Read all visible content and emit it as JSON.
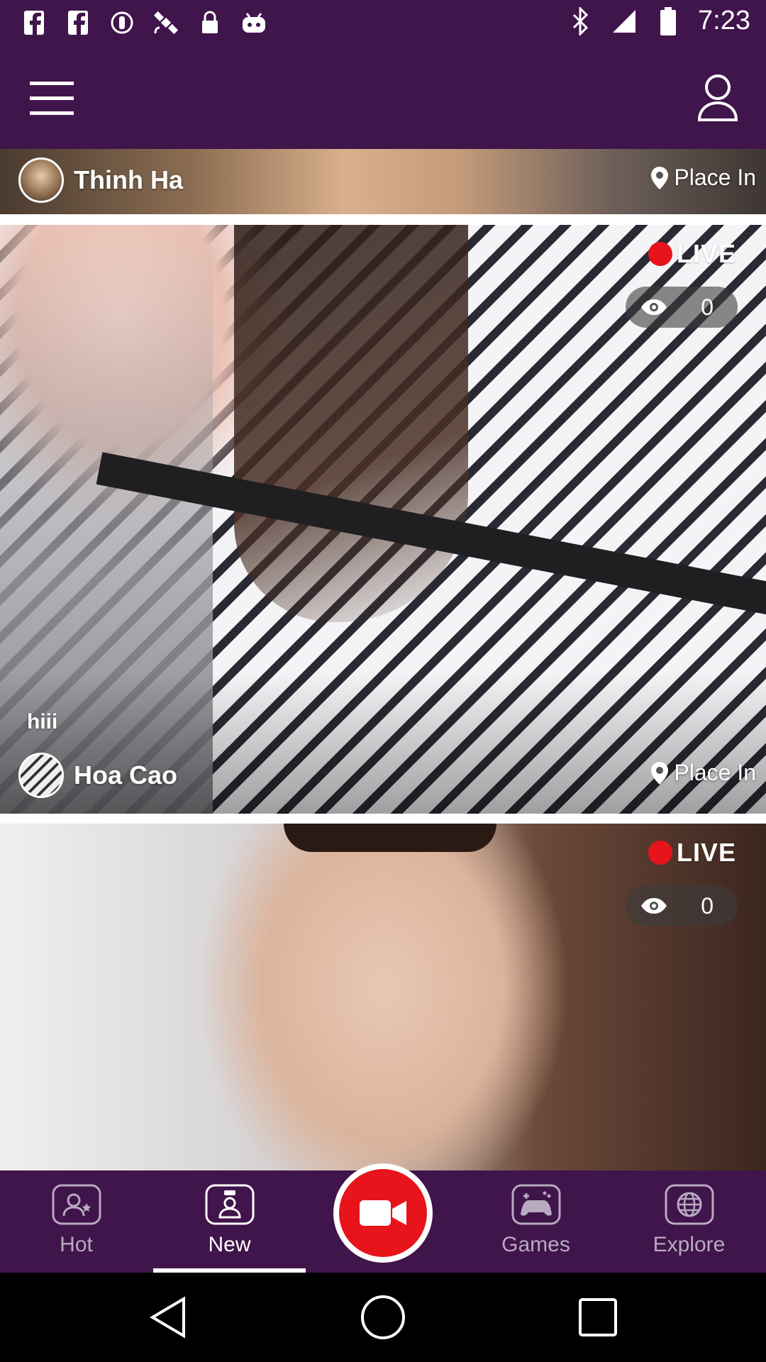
{
  "status_bar": {
    "time": "7:23",
    "icons": [
      "facebook-icon",
      "facebook-icon",
      "alert-circle-icon",
      "satellite-icon",
      "lock-icon",
      "android-icon",
      "bluetooth-icon",
      "cell-signal-icon",
      "battery-icon"
    ]
  },
  "app_bar": {
    "menu_icon": "menu-icon",
    "profile_icon": "profile-icon"
  },
  "feed": [
    {
      "username": "Thinh Ha",
      "place": "Place In"
    },
    {
      "live_label": "LIVE",
      "viewers": "0",
      "caption": "hiii",
      "username": "Hoa Cao",
      "place": "Place In"
    },
    {
      "live_label": "LIVE",
      "viewers": "0"
    }
  ],
  "bottom_nav": {
    "items": [
      {
        "label": "Hot",
        "icon": "hot-users-icon"
      },
      {
        "label": "New",
        "icon": "new-user-icon"
      },
      {
        "label": "Games",
        "icon": "gamepad-icon"
      },
      {
        "label": "Explore",
        "icon": "globe-icon"
      }
    ],
    "active": "New",
    "center_button_icon": "video-camera-icon"
  },
  "system_nav": [
    "back-icon",
    "home-icon",
    "recents-icon"
  ],
  "colors": {
    "primary": "#40154b",
    "live_red": "#e8141b",
    "inactive_label": "#b8aac0"
  }
}
